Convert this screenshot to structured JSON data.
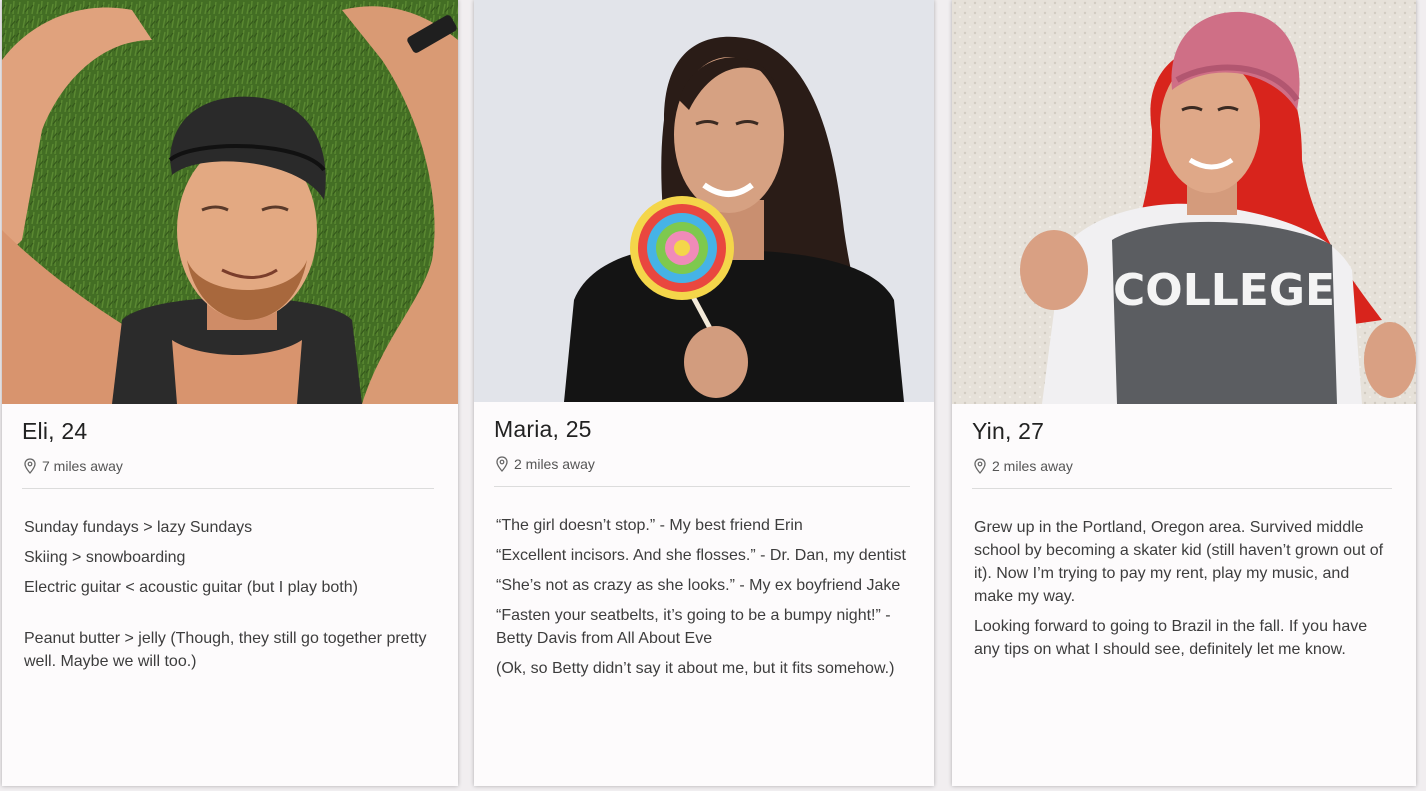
{
  "profiles": [
    {
      "name": "Eli, 24",
      "distance": "7 miles away",
      "bio": [
        "Sunday fundays > lazy Sundays",
        "Skiing > snowboarding",
        "Electric guitar < acoustic guitar (but I play both)",
        "Peanut butter > jelly (Though, they still go together pretty well. Maybe we will too.)"
      ]
    },
    {
      "name": "Maria, 25",
      "distance": "2 miles away",
      "bio": [
        "“The girl doesn’t stop.” - My best friend Erin",
        "“Excellent incisors. And she flosses.” - Dr. Dan, my dentist",
        "“She’s not as crazy as she looks.” - My ex boyfriend Jake",
        "“Fasten your seatbelts, it’s going to be a bumpy night!” - Betty Davis from All About Eve",
        "(Ok, so Betty didn’t say it about me, but it fits somehow.)"
      ]
    },
    {
      "name": "Yin, 27",
      "distance": "2 miles away",
      "sweatshirt_text": "COLLEGE",
      "bio": [
        "Grew up in the Portland, Oregon area. Survived middle school by becoming a skater kid (still haven’t grown out of it). Now I’m trying to pay my rent, play my music, and make my way.",
        "Looking forward to going to Brazil in the fall. If you have any tips on what I should see, definitely let me know."
      ]
    }
  ]
}
